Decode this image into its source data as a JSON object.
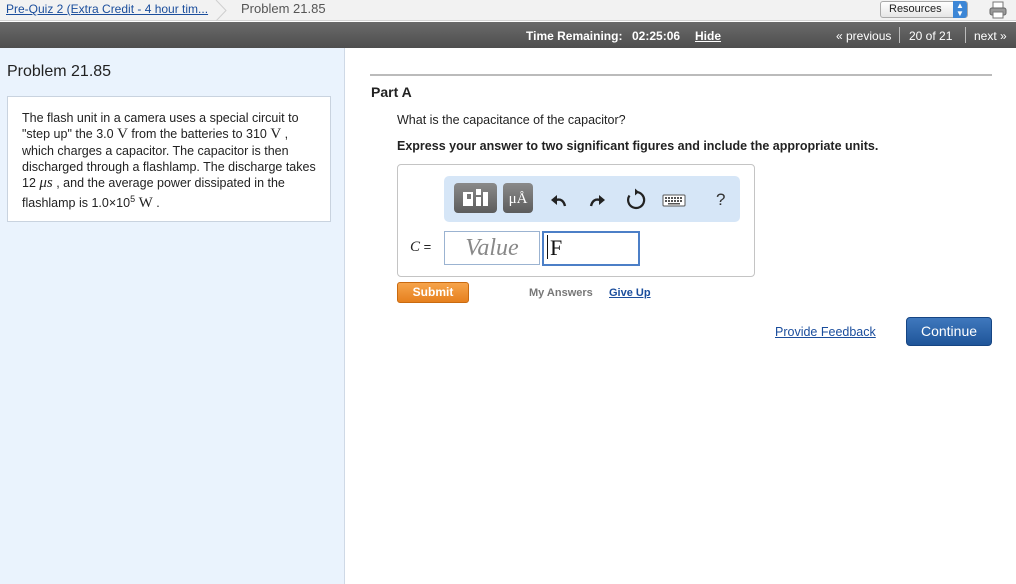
{
  "breadcrumb": {
    "assignment_link": "Pre-Quiz 2 (Extra Credit - 4 hour tim...",
    "current": "Problem 21.85"
  },
  "header": {
    "resources_select": "Resources",
    "timer_label": "Time Remaining:",
    "timer_value": "02:25:06",
    "hide_label": "Hide",
    "previous_label": "« previous",
    "position": "20 of 21",
    "next_label": "next »"
  },
  "problem": {
    "title": "Problem 21.85",
    "statement": {
      "s1": "The flash unit in a camera uses a special circuit to \"step up\" the ",
      "v1": "3.0 ",
      "u1": "V",
      "s2": " from the batteries to ",
      "v2": "310 ",
      "u2": "V",
      "s3": " , which charges a capacitor. The capacitor is then discharged through a flashlamp. The discharge takes ",
      "v3": "12 ",
      "u3": "μs",
      "s4": " , and the average power dissipated in the flashlamp is ",
      "v4": "1.0×10",
      "exp4": "5",
      "u4": "W",
      "s5": " ."
    }
  },
  "part": {
    "title": "Part A",
    "question": "What is the capacitance of the capacitor?",
    "instruction": "Express your answer to two significant figures and include the appropriate units.",
    "toolbar": {
      "units_label": "μÅ",
      "help_label": "?"
    },
    "answer": {
      "variable": "C",
      "equals": " =",
      "value_placeholder": "Value",
      "unit_value": "F"
    },
    "submit_label": "Submit",
    "my_answers_label": "My Answers",
    "give_up_label": "Give Up"
  },
  "footer": {
    "feedback_label": "Provide Feedback",
    "continue_label": "Continue"
  }
}
